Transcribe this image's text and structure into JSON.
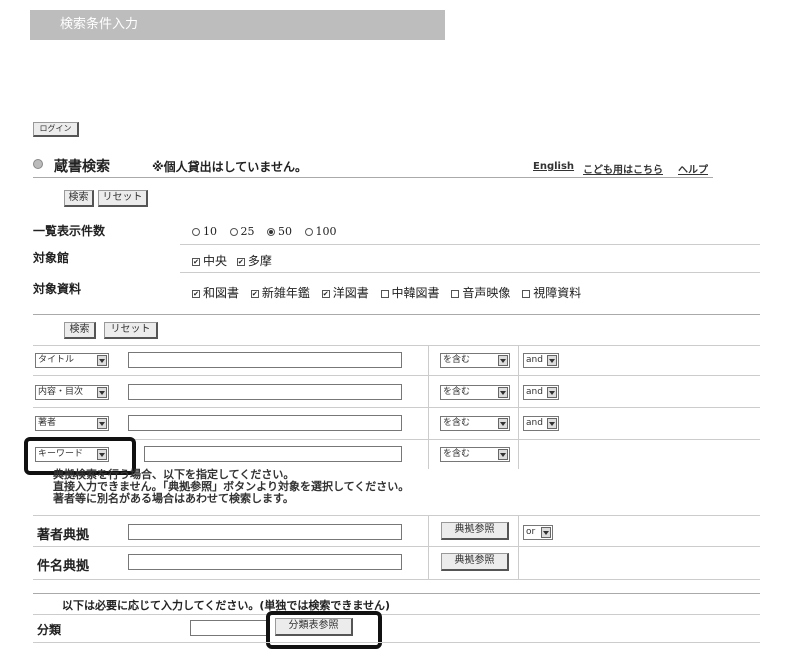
{
  "header": {
    "title": "検索条件入力"
  },
  "login_label": "ログイン",
  "section": {
    "title": "蔵書検索",
    "notice": "※個人貸出はしていません。",
    "links": [
      "English",
      "こども用はこちら",
      "ヘルプ"
    ]
  },
  "buttons": {
    "search": "検索",
    "reset": "リセット",
    "ref": "典拠参照",
    "class_ref": "分類表参照"
  },
  "settings": {
    "count_label": "一覧表示件数",
    "count_options": [
      "10",
      "25",
      "50",
      "100"
    ],
    "count_selected": "50",
    "library_label": "対象館",
    "libraries": [
      {
        "label": "中央",
        "checked": true
      },
      {
        "label": "多摩",
        "checked": true
      }
    ],
    "material_label": "対象資料",
    "materials": [
      {
        "label": "和図書",
        "checked": true
      },
      {
        "label": "新雑年鑑",
        "checked": true
      },
      {
        "label": "洋図書",
        "checked": true
      },
      {
        "label": "中韓図書",
        "checked": false
      },
      {
        "label": "音声映像",
        "checked": false
      },
      {
        "label": "視障資料",
        "checked": false
      }
    ]
  },
  "rows": [
    {
      "field": "タイトル",
      "match": "を含む",
      "logic": "and"
    },
    {
      "field": "内容・目次",
      "match": "を含む",
      "logic": "and"
    },
    {
      "field": "著者",
      "match": "を含む",
      "logic": "and"
    },
    {
      "field": "キーワード",
      "match": "を含む",
      "logic": ""
    }
  ],
  "authority_note": [
    "典拠検索を行う場合、以下を指定してください。",
    "直接入力できません。「典拠参照」ボタンより対象を選択してください。",
    "著者等に別名がある場合はあわせて検索します。"
  ],
  "authority": {
    "author_label": "著者典拠",
    "author_logic": "or",
    "subject_label": "件名典拠"
  },
  "optional_note": "以下は必要に応じて入力してください。(単独では検索できません)",
  "classification": {
    "label": "分類"
  }
}
